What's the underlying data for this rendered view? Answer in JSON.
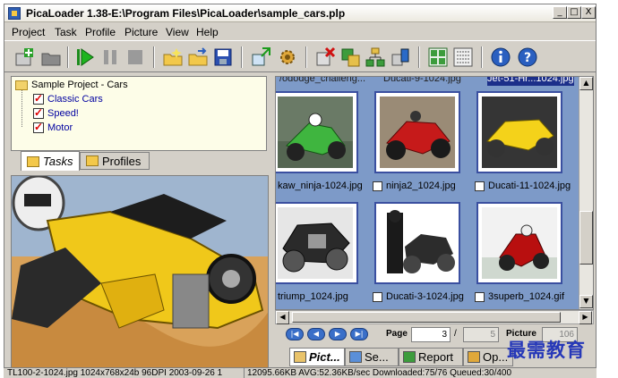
{
  "window": {
    "title": "PicaLoader 1.38-E:\\Program Files\\PicaLoader\\sample_cars.plp",
    "controls": {
      "minimize": "_",
      "maximize": "□",
      "close": "X"
    }
  },
  "menu": [
    {
      "label": "Project"
    },
    {
      "label": "Task"
    },
    {
      "label": "Profile"
    },
    {
      "label": "Picture"
    },
    {
      "label": "View"
    },
    {
      "label": "Help"
    }
  ],
  "toolbar": {
    "icons": [
      "new-task-icon",
      "open-folder-icon",
      "play-icon",
      "pause-icon",
      "stop-icon",
      "open-project-icon",
      "export-icon",
      "save-icon",
      "web-download-icon",
      "settings-icon",
      "delete-icon",
      "queue-add-icon",
      "network-icon",
      "transfer-icon",
      "thumbnail-view-icon",
      "list-view-icon",
      "info-icon",
      "help-icon"
    ]
  },
  "tree": {
    "root": "Sample Project - Cars",
    "children": [
      "Classic Cars",
      "Speed!",
      "Motor"
    ]
  },
  "left_tabs": [
    {
      "label": "Tasks",
      "active": true
    },
    {
      "label": "Profiles",
      "active": false
    }
  ],
  "thumbnails": {
    "top_partial": [
      "/ododge_challeng...",
      "Ducati-9-1024.jpg",
      "Jet-51-Hr...1024.jpg"
    ],
    "rows": [
      [
        "kaw_ninja-1024.jpg",
        "ninja2_1024.jpg",
        "Ducati-11-1024.jpg"
      ],
      [
        "triump_1024.jpg",
        "Ducati-3-1024.jpg",
        "3superb_1024.gif"
      ]
    ]
  },
  "pager": {
    "page_label": "Page",
    "page_value": "3",
    "separator": "/",
    "page_total": "5",
    "picture_label": "Picture",
    "picture_total": "106"
  },
  "right_tabs": [
    {
      "label": "Pict...",
      "active": true
    },
    {
      "label": "Se...",
      "active": false
    },
    {
      "label": "Report",
      "active": false
    },
    {
      "label": "Op...",
      "active": false
    }
  ],
  "status": {
    "file_info": "TL100-2-1024.jpg 1024x768x24b 96DPI 2003-09-26 1",
    "transfer_info": "12095.66KB AVG:52.36KB/sec Downloaded:75/76 Queued:30/400"
  },
  "watermark": "最需教育"
}
